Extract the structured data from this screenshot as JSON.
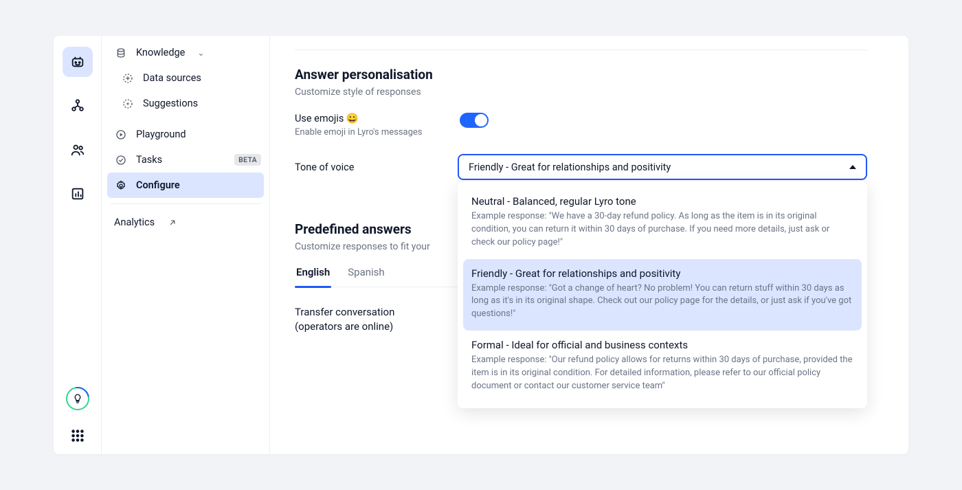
{
  "rail": {
    "items": [
      "bot-icon",
      "network-icon",
      "users-icon",
      "chart-icon"
    ]
  },
  "sidebar": {
    "knowledge": "Knowledge",
    "data_sources": "Data sources",
    "suggestions": "Suggestions",
    "playground": "Playground",
    "tasks": "Tasks",
    "tasks_badge": "BETA",
    "configure": "Configure",
    "analytics": "Analytics"
  },
  "sections": {
    "personalisation": {
      "title": "Answer personalisation",
      "subtitle": "Customize style of responses",
      "emoji_label": "Use emojis 😀",
      "emoji_hint": "Enable emoji in Lyro's messages",
      "tone_label": "Tone of voice",
      "tone_selected": "Friendly - Great for relationships and positivity",
      "tone_options": [
        {
          "title": "Neutral - Balanced, regular Lyro tone",
          "example": "Example response: \"We have a 30-day refund policy. As long as the item is in its original condition, you can return it within 30 days of purchase. If you need more details, just ask or check our policy page!\""
        },
        {
          "title": "Friendly - Great for relationships and positivity",
          "example": "Example response: \"Got a change of heart? No problem! You can return stuff within 30 days as long as it's in its original shape. Check out our policy page for the details, or just ask if you've got questions!\""
        },
        {
          "title": "Formal - Ideal for official and business contexts",
          "example": "Example response: \"Our refund policy allows for returns within 30 days of purchase, provided the item is in its original condition. For detailed information, please refer to our official policy document or contact our customer service team\""
        }
      ]
    },
    "predefined": {
      "title": "Predefined answers",
      "subtitle": "Customize responses to fit your",
      "tabs": [
        "English",
        "Spanish"
      ],
      "transfer_label": "Transfer conversation (operators are online)"
    }
  }
}
